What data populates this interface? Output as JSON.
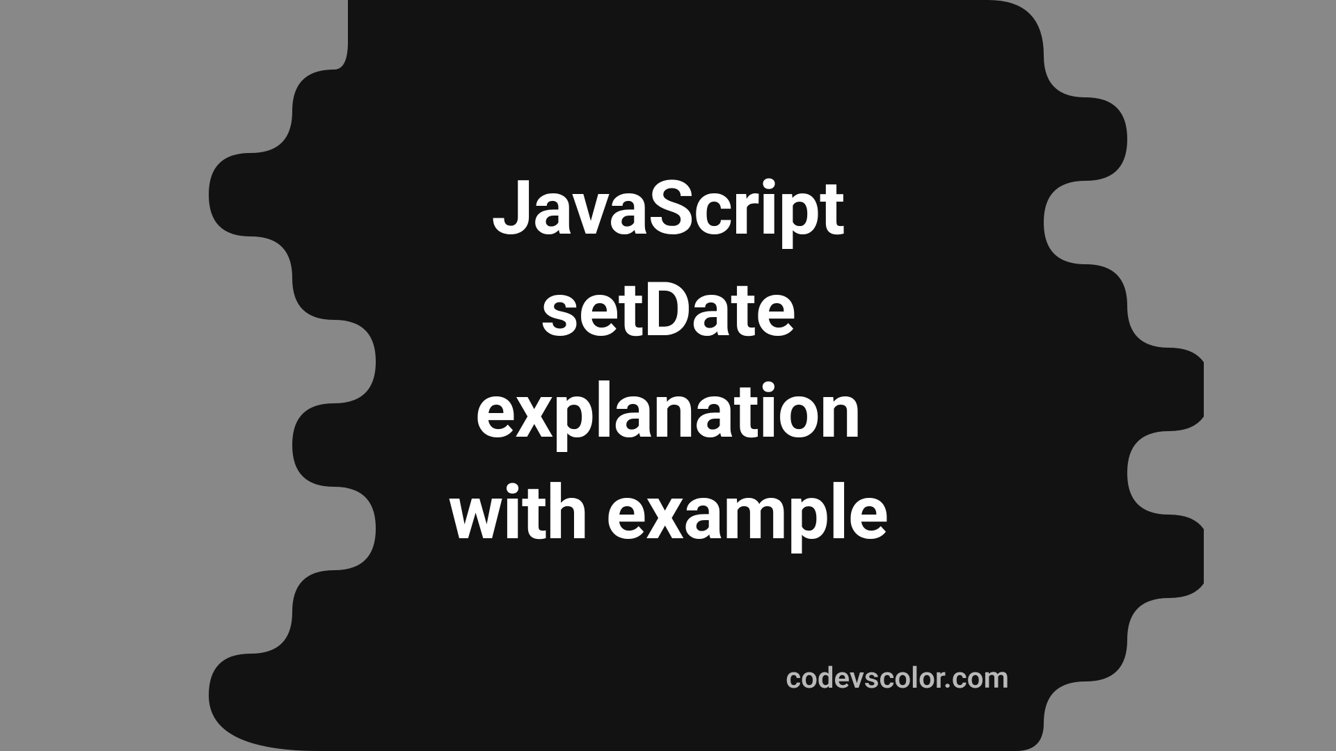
{
  "title": {
    "line1": "JavaScript",
    "line2": "setDate",
    "line3": "explanation",
    "line4": "with example"
  },
  "site": "codevscolor.com",
  "colors": {
    "background": "#888888",
    "blob": "#121212",
    "text": "#ffffff",
    "siteText": "#b8b8b8"
  }
}
